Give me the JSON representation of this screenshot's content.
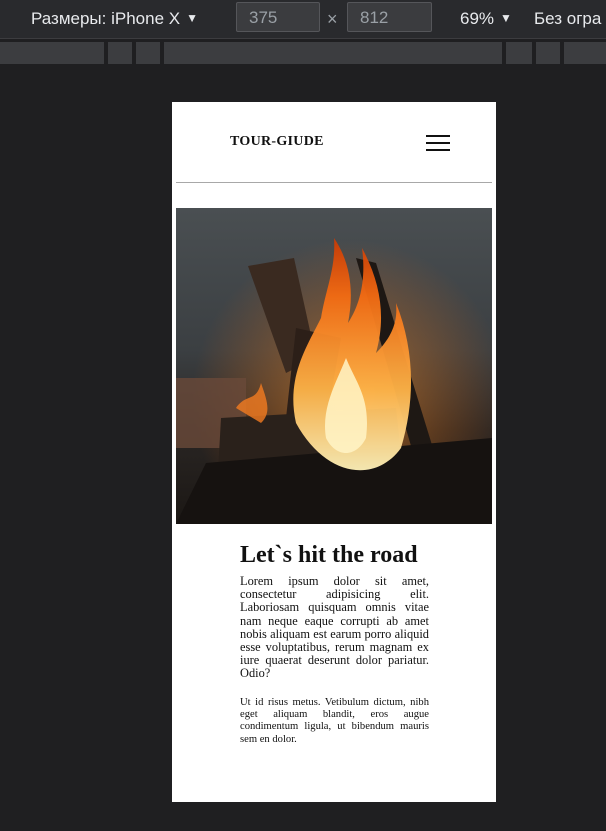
{
  "toolbar": {
    "dimensions_label": "Размеры: iPhone X",
    "width_value": "375",
    "times_sign": "×",
    "height_value": "812",
    "zoom_value": "69%",
    "throttle_label": "Без огра"
  },
  "site": {
    "logo": "TOUR-GIUDE",
    "headline": "Let`s hit the road",
    "paragraph1": "Lorem ipsum dolor sit amet, consectetur adipisicing elit. Laboriosam quisquam omnis vitae nam neque eaque corrupti ab amet nobis aliquam est earum porro aliquid esse voluptatibus, rerum magnam ex iure quaerat deserunt dolor pariatur. Odio?",
    "paragraph2": "Ut id risus metus. Vetibulum dictum, nibh eget aliquam blandit, eros augue condimentum ligula, ut bibendum mauris sem en dolor."
  },
  "icons": {
    "dimensions_caret": "chevron-down-icon",
    "zoom_caret": "chevron-down-icon",
    "menu": "hamburger-menu-icon"
  },
  "colors": {
    "devtools_bg": "#1f1f21",
    "toolbar_bg": "#292a2d",
    "flame": "#f47c20"
  }
}
